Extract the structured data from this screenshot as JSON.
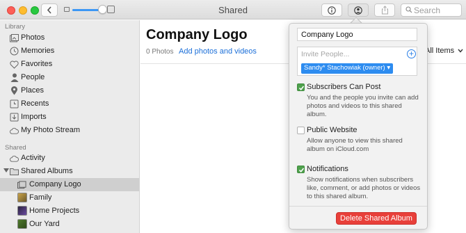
{
  "window": {
    "title": "Shared",
    "zoom_level_fraction": 0.83,
    "search_placeholder": "Search"
  },
  "sidebar": {
    "library_header": "Library",
    "library_items": [
      {
        "label": "Photos",
        "icon": "photos-icon"
      },
      {
        "label": "Memories",
        "icon": "memories-icon"
      },
      {
        "label": "Favorites",
        "icon": "heart-icon"
      },
      {
        "label": "People",
        "icon": "person-icon"
      },
      {
        "label": "Places",
        "icon": "pin-icon"
      },
      {
        "label": "Recents",
        "icon": "clock-icon"
      },
      {
        "label": "Imports",
        "icon": "import-icon"
      },
      {
        "label": "My Photo Stream",
        "icon": "cloud-icon"
      }
    ],
    "shared_header": "Shared",
    "shared_items": [
      {
        "label": "Activity",
        "icon": "cloud-icon"
      },
      {
        "label": "Shared Albums",
        "icon": "folder-icon"
      }
    ],
    "albums": [
      {
        "label": "Company Logo",
        "selected": true
      },
      {
        "label": "Family",
        "selected": false
      },
      {
        "label": "Home Projects",
        "selected": false
      },
      {
        "label": "Our Yard",
        "selected": false
      }
    ]
  },
  "main": {
    "album_title": "Company Logo",
    "photo_count": "0 Photos",
    "add_link": "Add photos and videos",
    "filter_label": "All Items"
  },
  "popover": {
    "album_name": "Company Logo",
    "invite_placeholder": "Invite People...",
    "invitee_token": "Sandy* Stachowiak (owner)",
    "options": [
      {
        "title": "Subscribers Can Post",
        "checked": true,
        "description": "You and the people you invite can add photos and videos to this shared album."
      },
      {
        "title": "Public Website",
        "checked": false,
        "description": "Allow anyone to view this shared album on iCloud.com"
      },
      {
        "title": "Notifications",
        "checked": true,
        "description": "Show notifications when subscribers like, comment, or add photos or videos to this shared album."
      }
    ],
    "delete_label": "Delete Shared Album"
  },
  "colors": {
    "accent": "#2d8cf0",
    "checkbox_on": "#4fa14d",
    "delete_red": "#e8403a",
    "sidebar_bg": "#ebebeb"
  }
}
